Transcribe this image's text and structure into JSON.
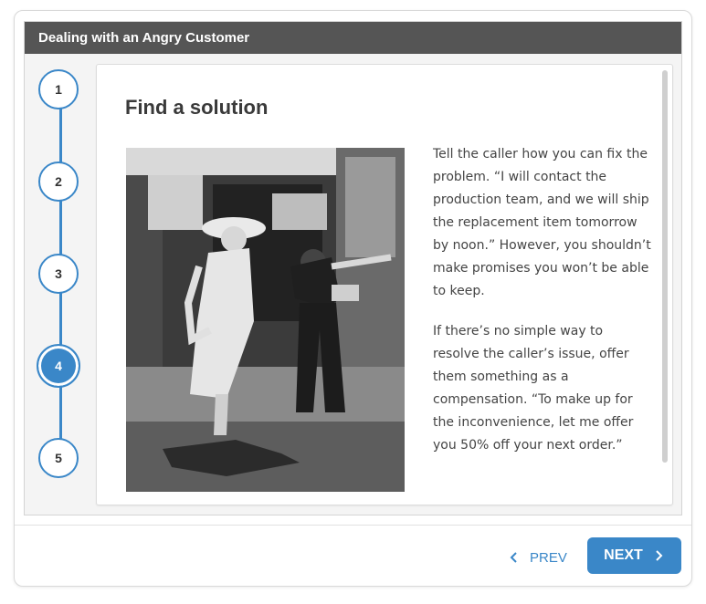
{
  "window": {
    "title": "Dealing with an Angry Customer"
  },
  "steps": [
    {
      "label": "1"
    },
    {
      "label": "2"
    },
    {
      "label": "3"
    },
    {
      "label": "4",
      "active": true
    },
    {
      "label": "5"
    }
  ],
  "slide": {
    "heading": "Find a solution",
    "image_description": "black-and-white photo",
    "paragraphs": [
      "Tell the caller how you can fix the problem. “I will contact the production team, and we will ship the replacement item tomorrow by noon.” However, you shouldn’t make promises you won’t be able to keep.",
      "If there’s no simple way to resolve the caller’s issue, offer them something as a compensation. “To make up for the inconvenience, let me offer you 50% off your next order.”"
    ]
  },
  "nav": {
    "prev_label": "PREV",
    "next_label": "NEXT"
  },
  "colors": {
    "accent": "#3a87c8",
    "titlebar": "#555555"
  },
  "icons": {
    "prev": "chevron-left-icon",
    "next": "chevron-right-icon"
  }
}
